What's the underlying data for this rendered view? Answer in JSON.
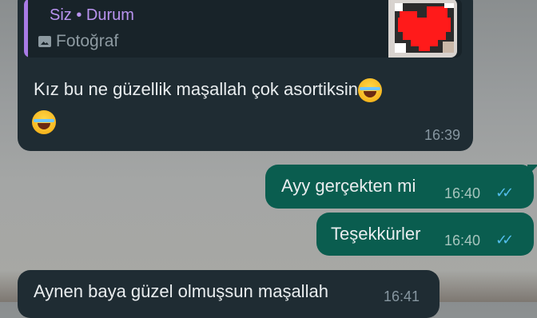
{
  "messages": [
    {
      "direction": "incoming",
      "reply_to": {
        "sender_status": "Siz • Durum",
        "media_type": "Fotoğraf"
      },
      "text": "Kız bu ne güzellik maşallah çok asortiksin",
      "time": "16:39"
    },
    {
      "direction": "outgoing",
      "text": "Ayy gerçekten mi",
      "time": "16:40",
      "status": "read"
    },
    {
      "direction": "outgoing",
      "text": "Teşekkürler",
      "time": "16:40",
      "status": "read"
    },
    {
      "direction": "incoming",
      "text": "Aynen baya güzel olmuşsun maşallah",
      "time": "16:41"
    }
  ],
  "icons": {
    "photo": "photo-icon",
    "emoji": "tears-of-joy-emoji",
    "read": "double-check-icon"
  },
  "colors": {
    "incoming_bubble": "#1f2c33",
    "outgoing_bubble": "#0a5d4f",
    "quote_accent": "#a97be6",
    "read_ticks": "#53bdeb"
  }
}
